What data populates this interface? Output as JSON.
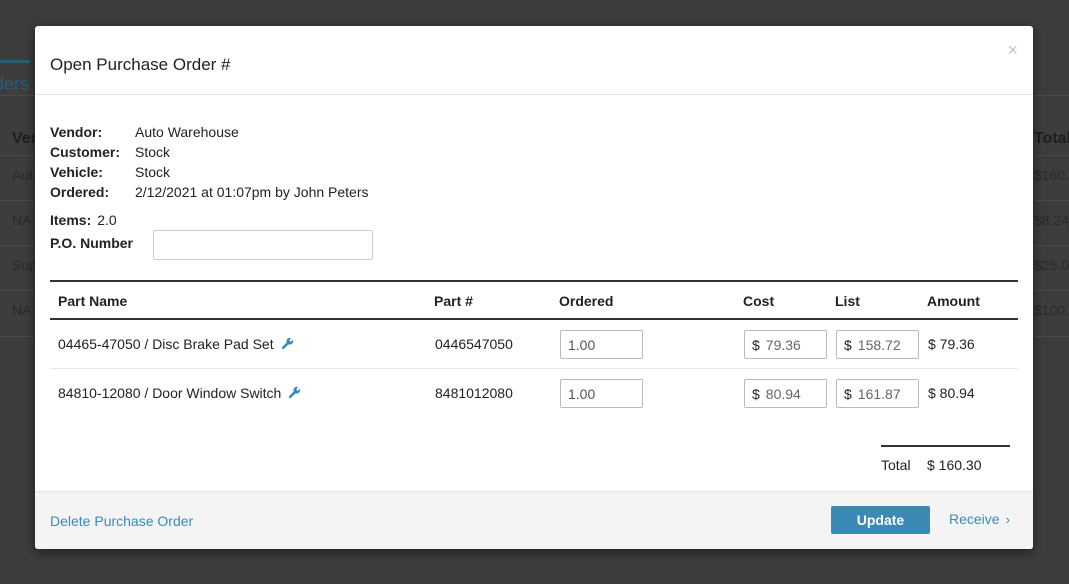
{
  "background": {
    "tab_label": "ders",
    "headers": {
      "vendor": "Ven",
      "total": "Total"
    },
    "rows": [
      {
        "vendor": "Aut",
        "total": "$160.3"
      },
      {
        "vendor": "NA",
        "total": "$8.24"
      },
      {
        "vendor": "Sup",
        "total": "$25.0"
      },
      {
        "vendor": "NA",
        "total": "$100.0"
      }
    ]
  },
  "modal": {
    "title": "Open Purchase Order #",
    "close_symbol": "×",
    "info": {
      "vendor_label": "Vendor:",
      "vendor": "Auto Warehouse",
      "customer_label": "Customer:",
      "customer": "Stock",
      "vehicle_label": "Vehicle:",
      "vehicle": "Stock",
      "ordered_label": "Ordered:",
      "ordered": "2/12/2021 at 01:07pm by John Peters"
    },
    "items_label": "Items:",
    "items_value": "2.0",
    "po_label": "P.O. Number",
    "po_value": "",
    "table": {
      "headers": {
        "part_name": "Part Name",
        "part_num": "Part #",
        "ordered": "Ordered",
        "cost": "Cost",
        "list": "List",
        "amount": "Amount"
      },
      "rows": [
        {
          "part_name": "04465-47050 / Disc Brake Pad Set",
          "part_num": "0446547050",
          "ordered": "1.00",
          "cost": "79.36",
          "list": "158.72",
          "amount": "$ 79.36"
        },
        {
          "part_name": "84810-12080 / Door Window Switch",
          "part_num": "8481012080",
          "ordered": "1.00",
          "cost": "80.94",
          "list": "161.87",
          "amount": "$ 80.94"
        }
      ],
      "currency": "$"
    },
    "total_label": "Total",
    "total_value": "$ 160.30",
    "footer": {
      "delete_label": "Delete Purchase Order",
      "update_label": "Update",
      "receive_label": "Receive",
      "receive_chevron": "›"
    }
  },
  "colors": {
    "accent": "#3a8ab5",
    "overlay": "#3d3d3d"
  }
}
